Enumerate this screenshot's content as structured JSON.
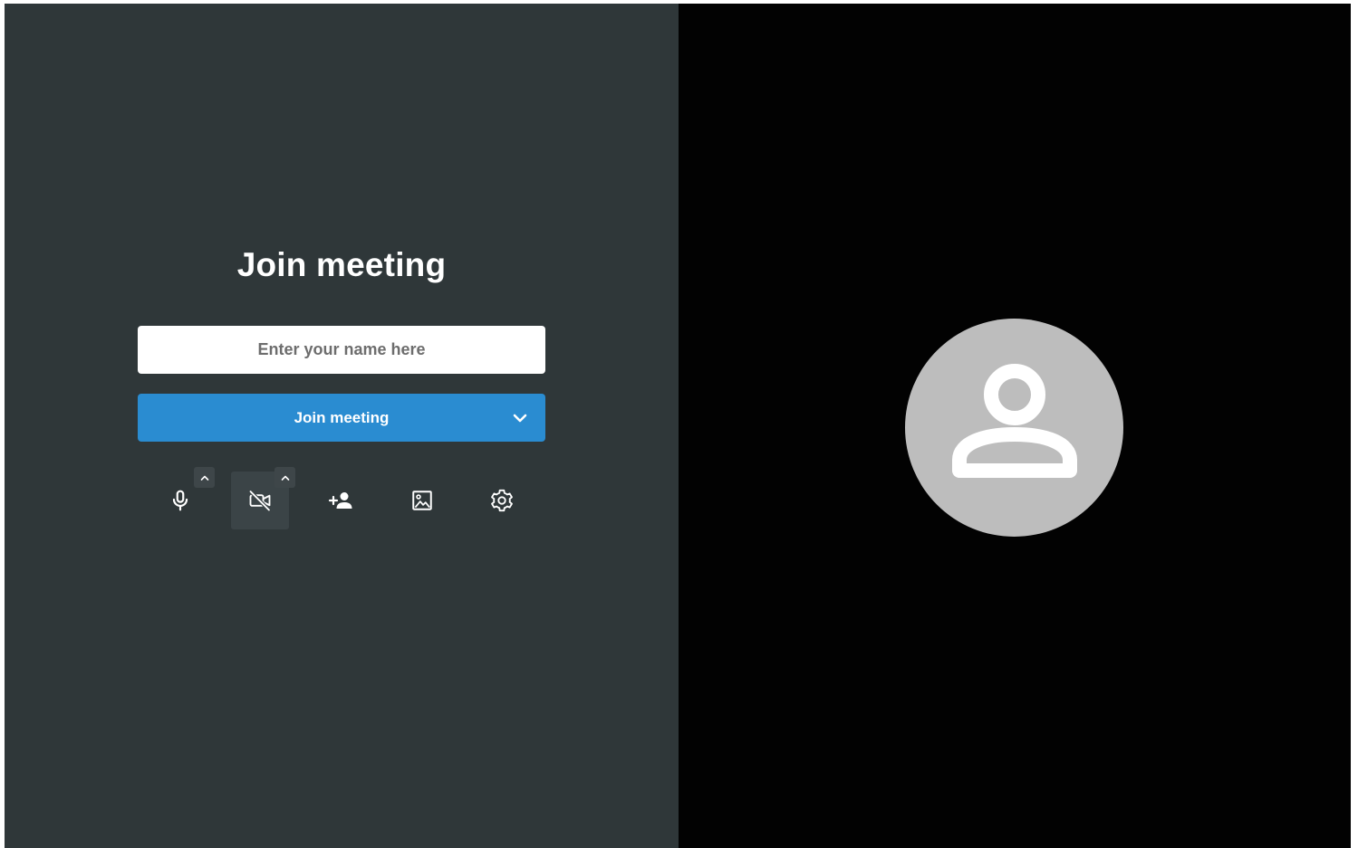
{
  "prejoin": {
    "title": "Join meeting",
    "name_input": {
      "placeholder": "Enter your name here",
      "value": ""
    },
    "join_button": {
      "label": "Join meeting"
    }
  },
  "toolbar": {
    "buttons": [
      {
        "icon": "microphone-icon",
        "has_options": true,
        "active": false
      },
      {
        "icon": "video-off-icon",
        "has_options": true,
        "active": true
      },
      {
        "icon": "add-person-icon",
        "has_options": false,
        "active": false
      },
      {
        "icon": "image-icon",
        "has_options": false,
        "active": false
      },
      {
        "icon": "gear-icon",
        "has_options": false,
        "active": false
      }
    ]
  },
  "preview": {
    "icon": "person-icon"
  },
  "colors": {
    "left_panel_bg": "#2f3739",
    "right_panel_bg": "#020202",
    "accent": "#2a8cd1",
    "avatar_bg": "#bdbdbd"
  }
}
